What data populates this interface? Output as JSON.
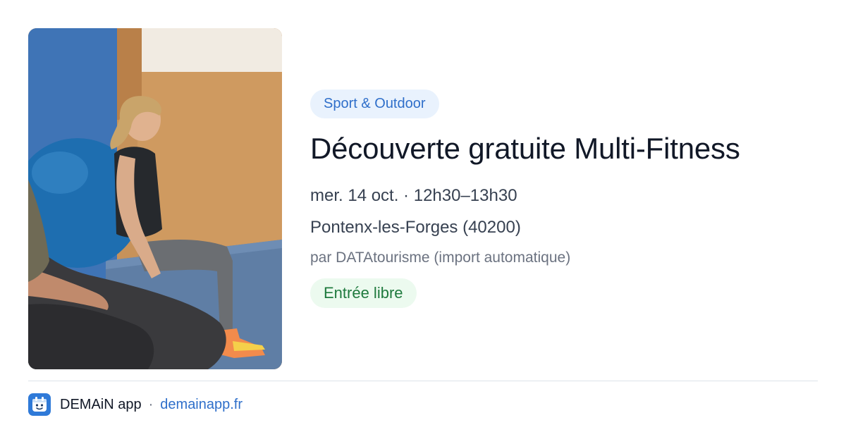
{
  "event": {
    "category": "Sport & Outdoor",
    "title": "Découverte gratuite Multi-Fitness",
    "datetime": "mer. 14 oct. · 12h30–13h30",
    "location": "Pontenx-les-Forges (40200)",
    "organizer": "par DATAtourisme (import automatique)",
    "price": "Entrée libre"
  },
  "footer": {
    "app_name": "DEMAiN app",
    "separator": "·",
    "site": "demainapp.fr"
  },
  "colors": {
    "accent_blue": "#2f6fca",
    "category_chip_bg": "#e9f2fd",
    "price_chip_bg": "#ecfaef",
    "price_chip_text": "#1f7a3e",
    "title_text": "#111827"
  },
  "icons": {
    "app_logo": "calendar-face-icon"
  }
}
